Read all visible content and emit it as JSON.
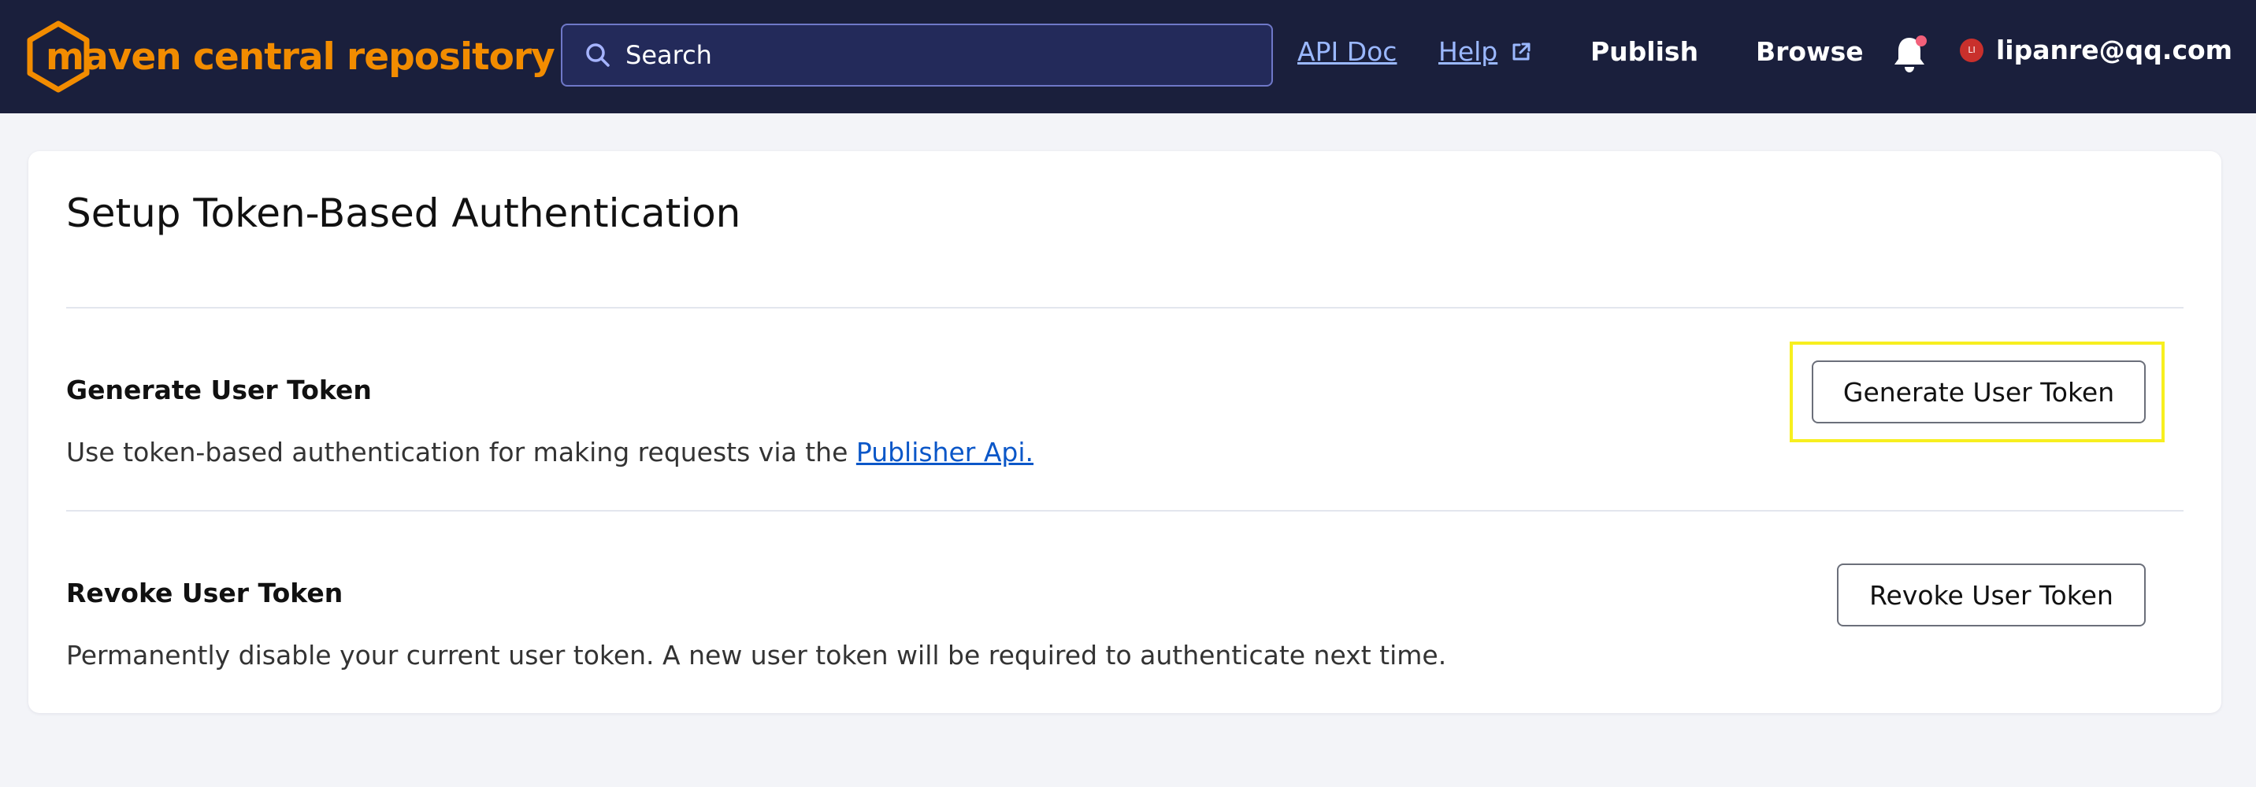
{
  "header": {
    "logo_text": "maven central repository",
    "search_placeholder": "Search",
    "nav": {
      "api_doc": "API Doc",
      "help": "Help",
      "publish": "Publish",
      "browse": "Browse"
    },
    "user": {
      "avatar_initials": "LI",
      "email": "lipanre@qq.com"
    },
    "colors": {
      "brand": "#f28c00",
      "bar": "#1a1f3c",
      "notification_dot": "#f2607a"
    }
  },
  "page": {
    "title": "Setup Token-Based Authentication",
    "generate": {
      "title": "Generate User Token",
      "description": "Use token-based authentication for making requests via the",
      "link_text": "Publisher Api.",
      "button_label": "Generate User Token"
    },
    "revoke": {
      "title": "Revoke User Token",
      "description": "Permanently disable your current user token. A new user token will be required to authenticate next time.",
      "button_label": "Revoke User Token"
    }
  },
  "icons": [
    "maven-hexagon-icon",
    "search-icon",
    "external-link-icon",
    "bell-icon"
  ]
}
